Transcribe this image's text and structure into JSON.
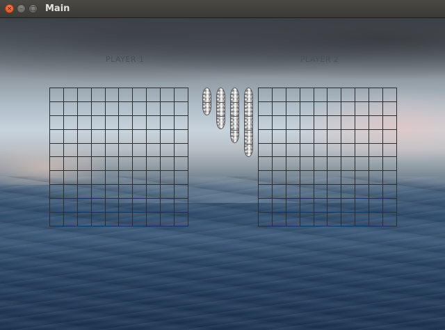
{
  "window": {
    "title": "Main",
    "buttons": {
      "close": "×",
      "minimize": "–",
      "maximize": "□"
    }
  },
  "board": {
    "rows": 10,
    "columns": 10,
    "players": [
      {
        "label": "PLAYER 1"
      },
      {
        "label": "PLAYER 2"
      }
    ]
  },
  "ships": [
    {
      "name": "ship-2",
      "length": 2
    },
    {
      "name": "ship-3",
      "length": 3
    },
    {
      "name": "ship-4",
      "length": 4
    },
    {
      "name": "ship-5",
      "length": 5
    }
  ],
  "colors": {
    "grid_line": "#2b2e31",
    "label": "#4b5056",
    "titlebar": "#3b3a36",
    "close_button": "#e0582a"
  }
}
